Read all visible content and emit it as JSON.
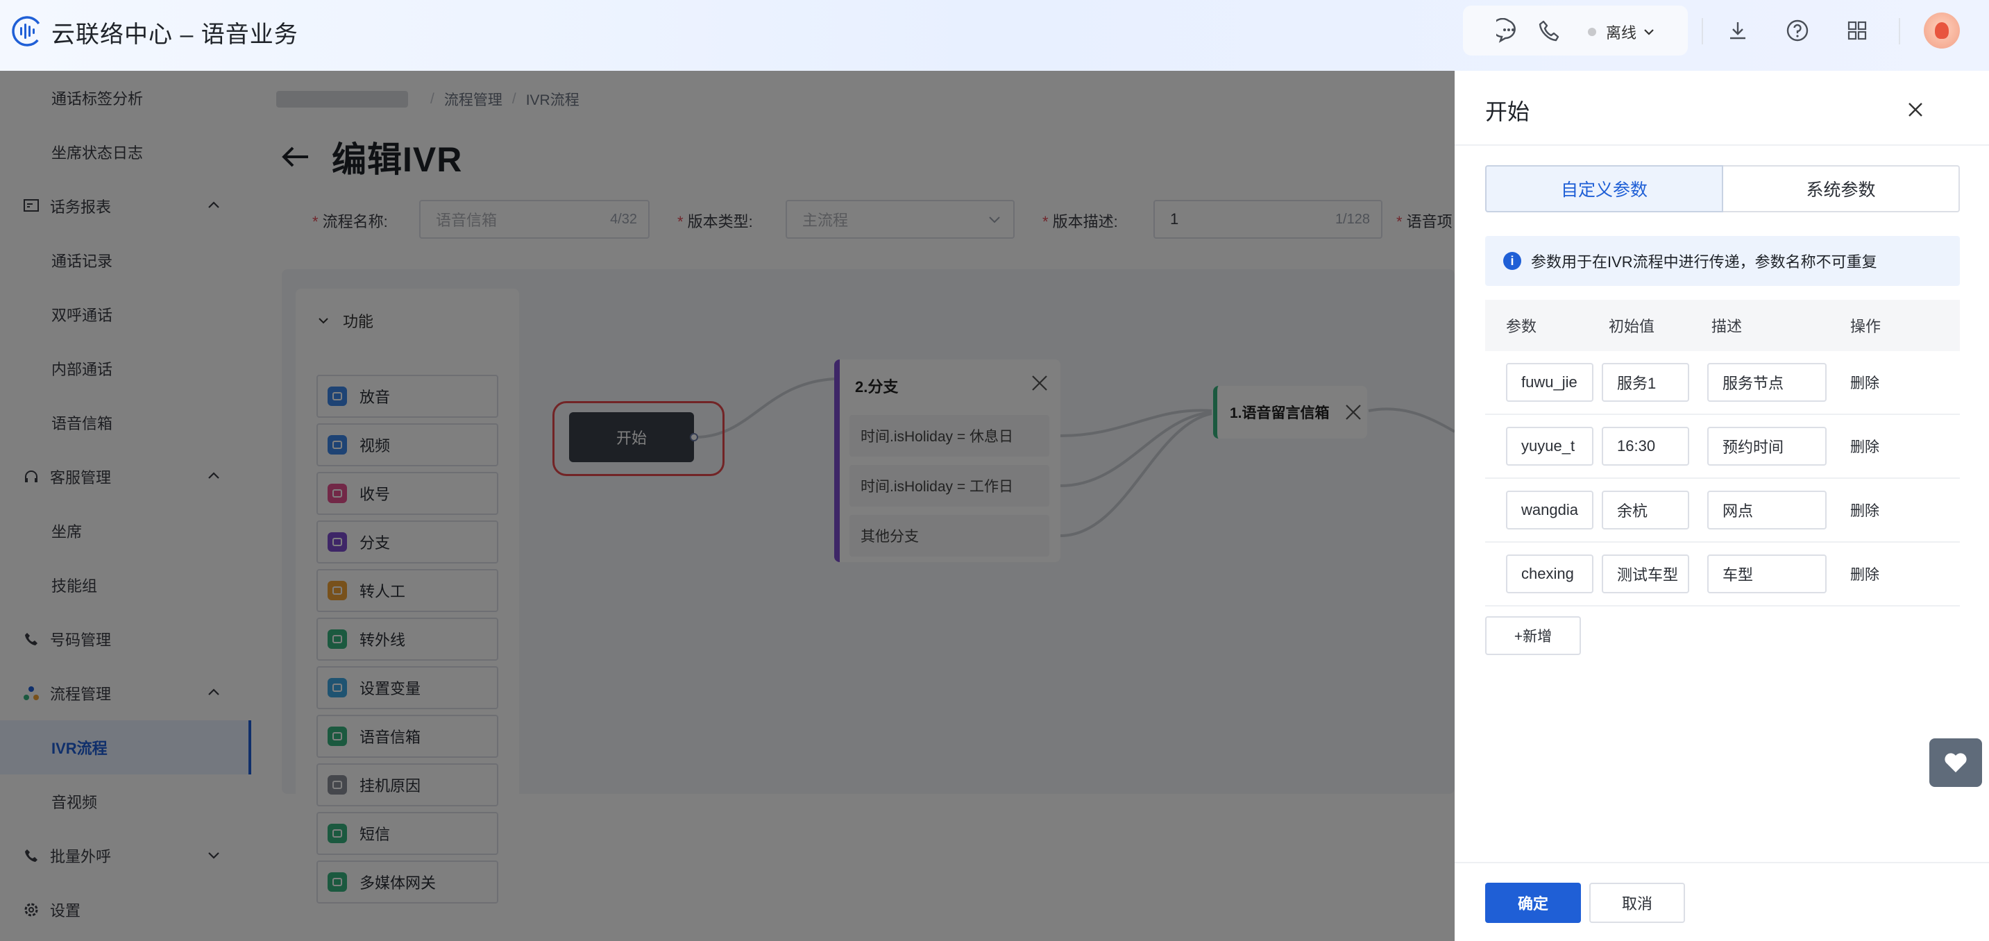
{
  "header": {
    "title": "云联络中心 – 语音业务",
    "status": "离线",
    "icons": [
      "waveform-logo-icon",
      "chat-icon",
      "phone-icon",
      "download-icon",
      "help-icon",
      "apps-grid-icon"
    ]
  },
  "sidebar": {
    "items": [
      {
        "label": "通话标签分析",
        "kind": "sub"
      },
      {
        "label": "坐席状态日志",
        "kind": "sub"
      },
      {
        "label": "话务报表",
        "kind": "group",
        "icon": "report-icon"
      },
      {
        "label": "通话记录",
        "kind": "sub"
      },
      {
        "label": "双呼通话",
        "kind": "sub"
      },
      {
        "label": "内部通话",
        "kind": "sub"
      },
      {
        "label": "语音信箱",
        "kind": "sub"
      },
      {
        "label": "客服管理",
        "kind": "group",
        "icon": "headset-icon"
      },
      {
        "label": "坐席",
        "kind": "sub"
      },
      {
        "label": "技能组",
        "kind": "sub"
      },
      {
        "label": "号码管理",
        "kind": "group",
        "icon": "phone-icon"
      },
      {
        "label": "流程管理",
        "kind": "group",
        "icon": "flow-icon"
      },
      {
        "label": "IVR流程",
        "kind": "sub",
        "active": true
      },
      {
        "label": "音视频",
        "kind": "sub"
      },
      {
        "label": "批量外呼",
        "kind": "group",
        "icon": "phone-icon"
      },
      {
        "label": "设置",
        "kind": "group",
        "icon": "gear-icon"
      }
    ]
  },
  "breadcrumb": {
    "items": [
      "流程管理",
      "IVR流程"
    ]
  },
  "page": {
    "title": "编辑IVR"
  },
  "form": {
    "name_label": "流程名称:",
    "name_placeholder": "语音信箱",
    "name_count": "4/32",
    "type_label": "版本类型:",
    "type_value": "主流程",
    "desc_label": "版本描述:",
    "desc_value": "1",
    "desc_count": "1/128",
    "project_label": "语音项目"
  },
  "palette": {
    "title": "功能",
    "items": [
      {
        "label": "放音",
        "color": "#3d86e8"
      },
      {
        "label": "视频",
        "color": "#3d86e8"
      },
      {
        "label": "收号",
        "color": "#e5508f"
      },
      {
        "label": "分支",
        "color": "#7c4dce"
      },
      {
        "label": "转人工",
        "color": "#f0a236"
      },
      {
        "label": "转外线",
        "color": "#36b37e"
      },
      {
        "label": "设置变量",
        "color": "#3fa7e3"
      },
      {
        "label": "语音信箱",
        "color": "#36b37e"
      },
      {
        "label": "挂机原因",
        "color": "#8a8f99"
      },
      {
        "label": "短信",
        "color": "#36b37e"
      },
      {
        "label": "多媒体网关",
        "color": "#36b37e"
      }
    ]
  },
  "flow": {
    "start_node": "开始",
    "branch_node": {
      "title": "2.分支",
      "rows": [
        "时间.isHoliday = 休息日",
        "时间.isHoliday = 工作日",
        "其他分支"
      ]
    },
    "voicemail_node": "1.语音留言信箱"
  },
  "drawer": {
    "title": "开始",
    "tabs": [
      "自定义参数",
      "系统参数"
    ],
    "notice": "参数用于在IVR流程中进行传递，参数名称不可重复",
    "table": {
      "headers": [
        "参数",
        "初始值",
        "描述",
        "操作"
      ],
      "rows": [
        {
          "param": "fuwu_jie",
          "init": "服务1",
          "desc": "服务节点",
          "action": "删除"
        },
        {
          "param": "yuyue_t",
          "init": "16:30",
          "desc": "预约时间",
          "action": "删除"
        },
        {
          "param": "wangdia",
          "init": "余杭",
          "desc": "网点",
          "action": "删除"
        },
        {
          "param": "chexing",
          "init": "测试车型",
          "desc": "车型",
          "action": "删除"
        }
      ]
    },
    "add_label": "+新增",
    "ok_label": "确定",
    "cancel_label": "取消"
  },
  "colors": {
    "primary": "#1f5fd6",
    "overlay": "rgba(0,0,0,0.5)",
    "danger_outline": "#e5484d"
  }
}
